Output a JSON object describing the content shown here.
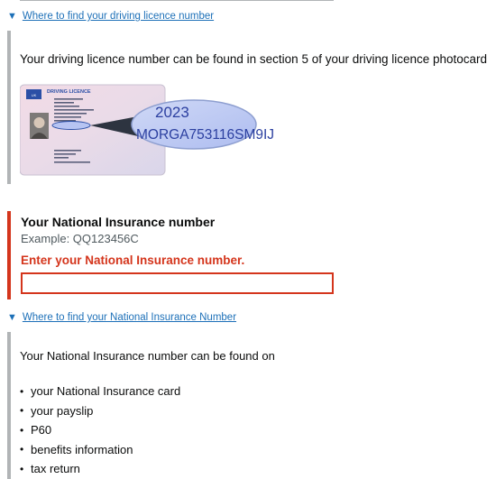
{
  "licence_details": {
    "summary": "Where to find your driving licence number",
    "text": "Your driving licence number can be found in section 5 of your driving licence photocard",
    "card": {
      "header": "DRIVING LICENCE",
      "country": "UK",
      "zoom_date": "2023",
      "zoom_number": "MORGA753116SM9IJ"
    }
  },
  "ni_field": {
    "label": "Your National Insurance number",
    "hint": "Example: QQ123456C",
    "error": "Enter your National Insurance number.",
    "value": "",
    "placeholder": ""
  },
  "ni_details": {
    "summary": "Where to find your National Insurance Number",
    "text": "Your National Insurance number can be found on",
    "items": [
      "your National Insurance card",
      "your payslip",
      "P60",
      "benefits information",
      "tax return"
    ]
  },
  "colors": {
    "link": "#1d70b8",
    "error": "#d4351c",
    "border_grey": "#b1b4b6"
  }
}
